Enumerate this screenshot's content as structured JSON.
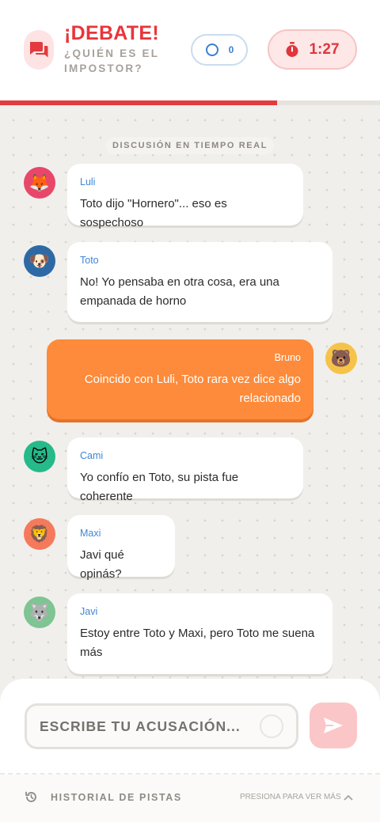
{
  "header": {
    "title": "¡DEBATE!",
    "subtitle": "¿QUIÉN ES EL IMPOSTOR?",
    "votes_count": "0",
    "timer": "1:27",
    "time_remaining_fraction": 0.73,
    "icons": {
      "logo": "chat-bubbles-icon",
      "votes": "circle-outline-icon",
      "timer": "stopwatch-icon"
    },
    "colors": {
      "accent": "#e8353b",
      "vote_blue": "#3b7fd0"
    }
  },
  "chat": {
    "section_label": "DISCUSIÓN EN TIEMPO REAL",
    "messages": [
      {
        "author": "Luli",
        "avatar": "🦊",
        "avatar_color": "#e8476a",
        "text": "Toto dijo \"Hornero\"... eso es sospechoso",
        "own": false
      },
      {
        "author": "Toto",
        "avatar": "🐶",
        "avatar_color": "#2d6aa5",
        "text": "No! Yo pensaba en otra cosa, era una empanada de horno",
        "own": false
      },
      {
        "author": "Bruno",
        "avatar": "🐻",
        "avatar_color": "#f6c349",
        "text": "Coincido con Luli, Toto rara vez dice algo relacionado",
        "own": true
      },
      {
        "author": "Cami",
        "avatar": "🐱",
        "avatar_color": "#26b98a",
        "text": "Yo confío en Toto, su pista fue coherente",
        "own": false
      },
      {
        "author": "Maxi",
        "avatar": "🦁",
        "avatar_color": "#f47a5b",
        "text": "Javi qué opinás?",
        "own": false
      },
      {
        "author": "Javi",
        "avatar": "🐺",
        "avatar_color": "#7fc493",
        "text": "Estoy entre Toto y Maxi, pero Toto me suena más",
        "own": false
      }
    ],
    "colors": {
      "own_bubble": "#fd8b3b",
      "name_blue": "#3f86d6"
    }
  },
  "composer": {
    "placeholder": "ESCRIBE TU ACUSACIÓN...",
    "value": "",
    "send_icon": "paper-plane-icon",
    "send_color": "#fbc6c8"
  },
  "footer": {
    "history_label": "HISTORIAL DE PISTAS",
    "hint": "PRESIONA PARA VER MÁS",
    "history_icon": "history-clock-icon",
    "expand_icon": "chevron-up-icon"
  }
}
